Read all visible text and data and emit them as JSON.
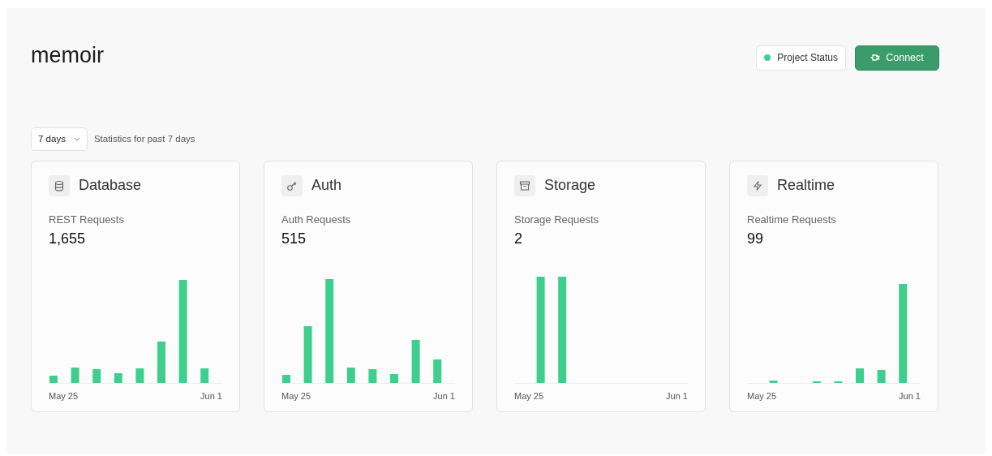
{
  "project": {
    "title": "memoir"
  },
  "header_actions": {
    "status": {
      "label": "Project Status",
      "color": "#3ecf8e"
    },
    "connect": {
      "label": "Connect"
    }
  },
  "period": {
    "value": "7 days",
    "description": "Statistics for past 7 days"
  },
  "cards": [
    {
      "kind": "database",
      "title": "Database",
      "metric": "REST Requests",
      "value": "1,655",
      "x_start": "May 25",
      "x_end": "Jun 1"
    },
    {
      "kind": "auth",
      "title": "Auth",
      "metric": "Auth Requests",
      "value": "515",
      "x_start": "May 25",
      "x_end": "Jun 1"
    },
    {
      "kind": "storage",
      "title": "Storage",
      "metric": "Storage Requests",
      "value": "2",
      "x_start": "May 25",
      "x_end": "Jun 1"
    },
    {
      "kind": "realtime",
      "title": "Realtime",
      "metric": "Realtime Requests",
      "value": "99",
      "x_start": "May 25",
      "x_end": "Jun 1"
    }
  ]
}
